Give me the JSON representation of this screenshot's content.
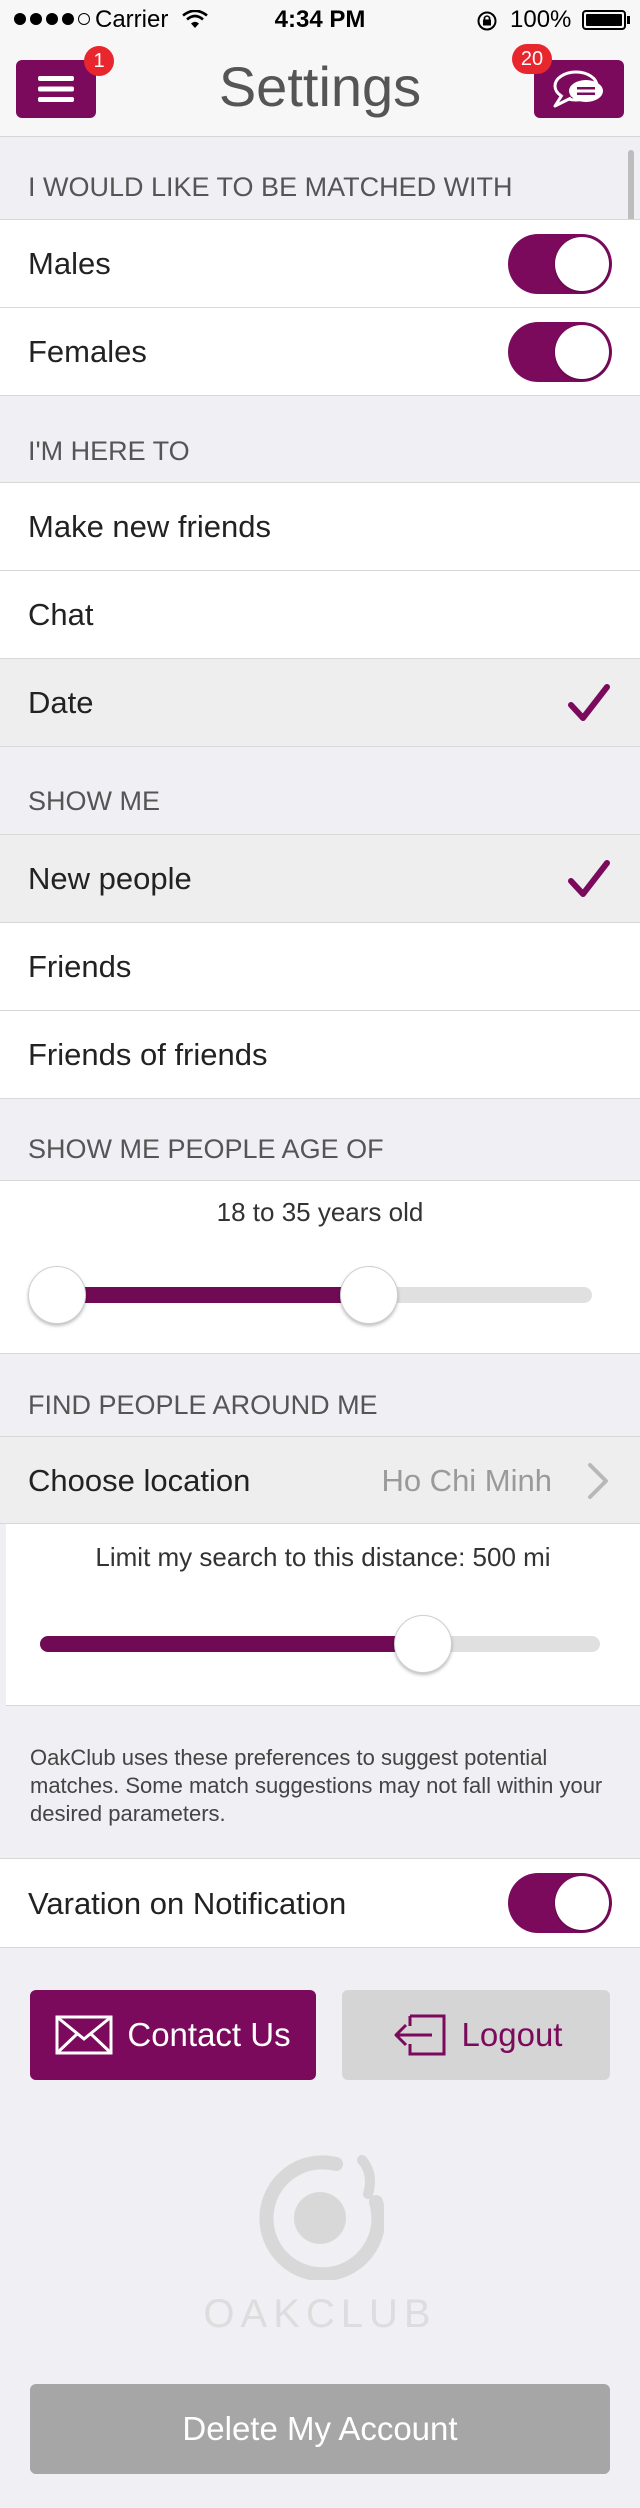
{
  "status_bar": {
    "carrier": "Carrier",
    "time": "4:34 PM",
    "battery": "100%",
    "signal_bars": 4
  },
  "nav": {
    "title": "Settings",
    "menu_badge": "1",
    "chat_badge": "20"
  },
  "matched_with": {
    "header": "I WOULD LIKE TO BE MATCHED WITH",
    "items": [
      {
        "label": "Males",
        "on": true
      },
      {
        "label": "Females",
        "on": true
      }
    ]
  },
  "here_to": {
    "header": "I'M HERE TO",
    "items": [
      {
        "label": "Make new friends",
        "selected": false
      },
      {
        "label": "Chat",
        "selected": false
      },
      {
        "label": "Date",
        "selected": true
      }
    ]
  },
  "show_me": {
    "header": "SHOW ME",
    "items": [
      {
        "label": "New people",
        "selected": true
      },
      {
        "label": "Friends",
        "selected": false
      },
      {
        "label": "Friends of friends",
        "selected": false
      }
    ]
  },
  "age": {
    "header": "SHOW ME PEOPLE AGE OF",
    "range_text": "18 to 35 years old",
    "min": 18,
    "max": 35
  },
  "location": {
    "header": "FIND PEOPLE AROUND ME",
    "choose_label": "Choose location",
    "value": "Ho Chi Minh",
    "distance_text": "Limit my search to this distance: 500 mi",
    "distance_mi": 500
  },
  "note": "OakClub uses these preferences to suggest potential matches. Some match suggestions may not fall within your desired parameters.",
  "notification": {
    "label": "Varation on Notification",
    "on": true
  },
  "buttons": {
    "contact": "Contact Us",
    "logout": "Logout",
    "delete": "Delete My Account"
  },
  "logo": {
    "text": "OAKCLUB"
  },
  "colors": {
    "accent": "#7b0a5c",
    "badge": "#e8262d",
    "background": "#efeff4"
  }
}
